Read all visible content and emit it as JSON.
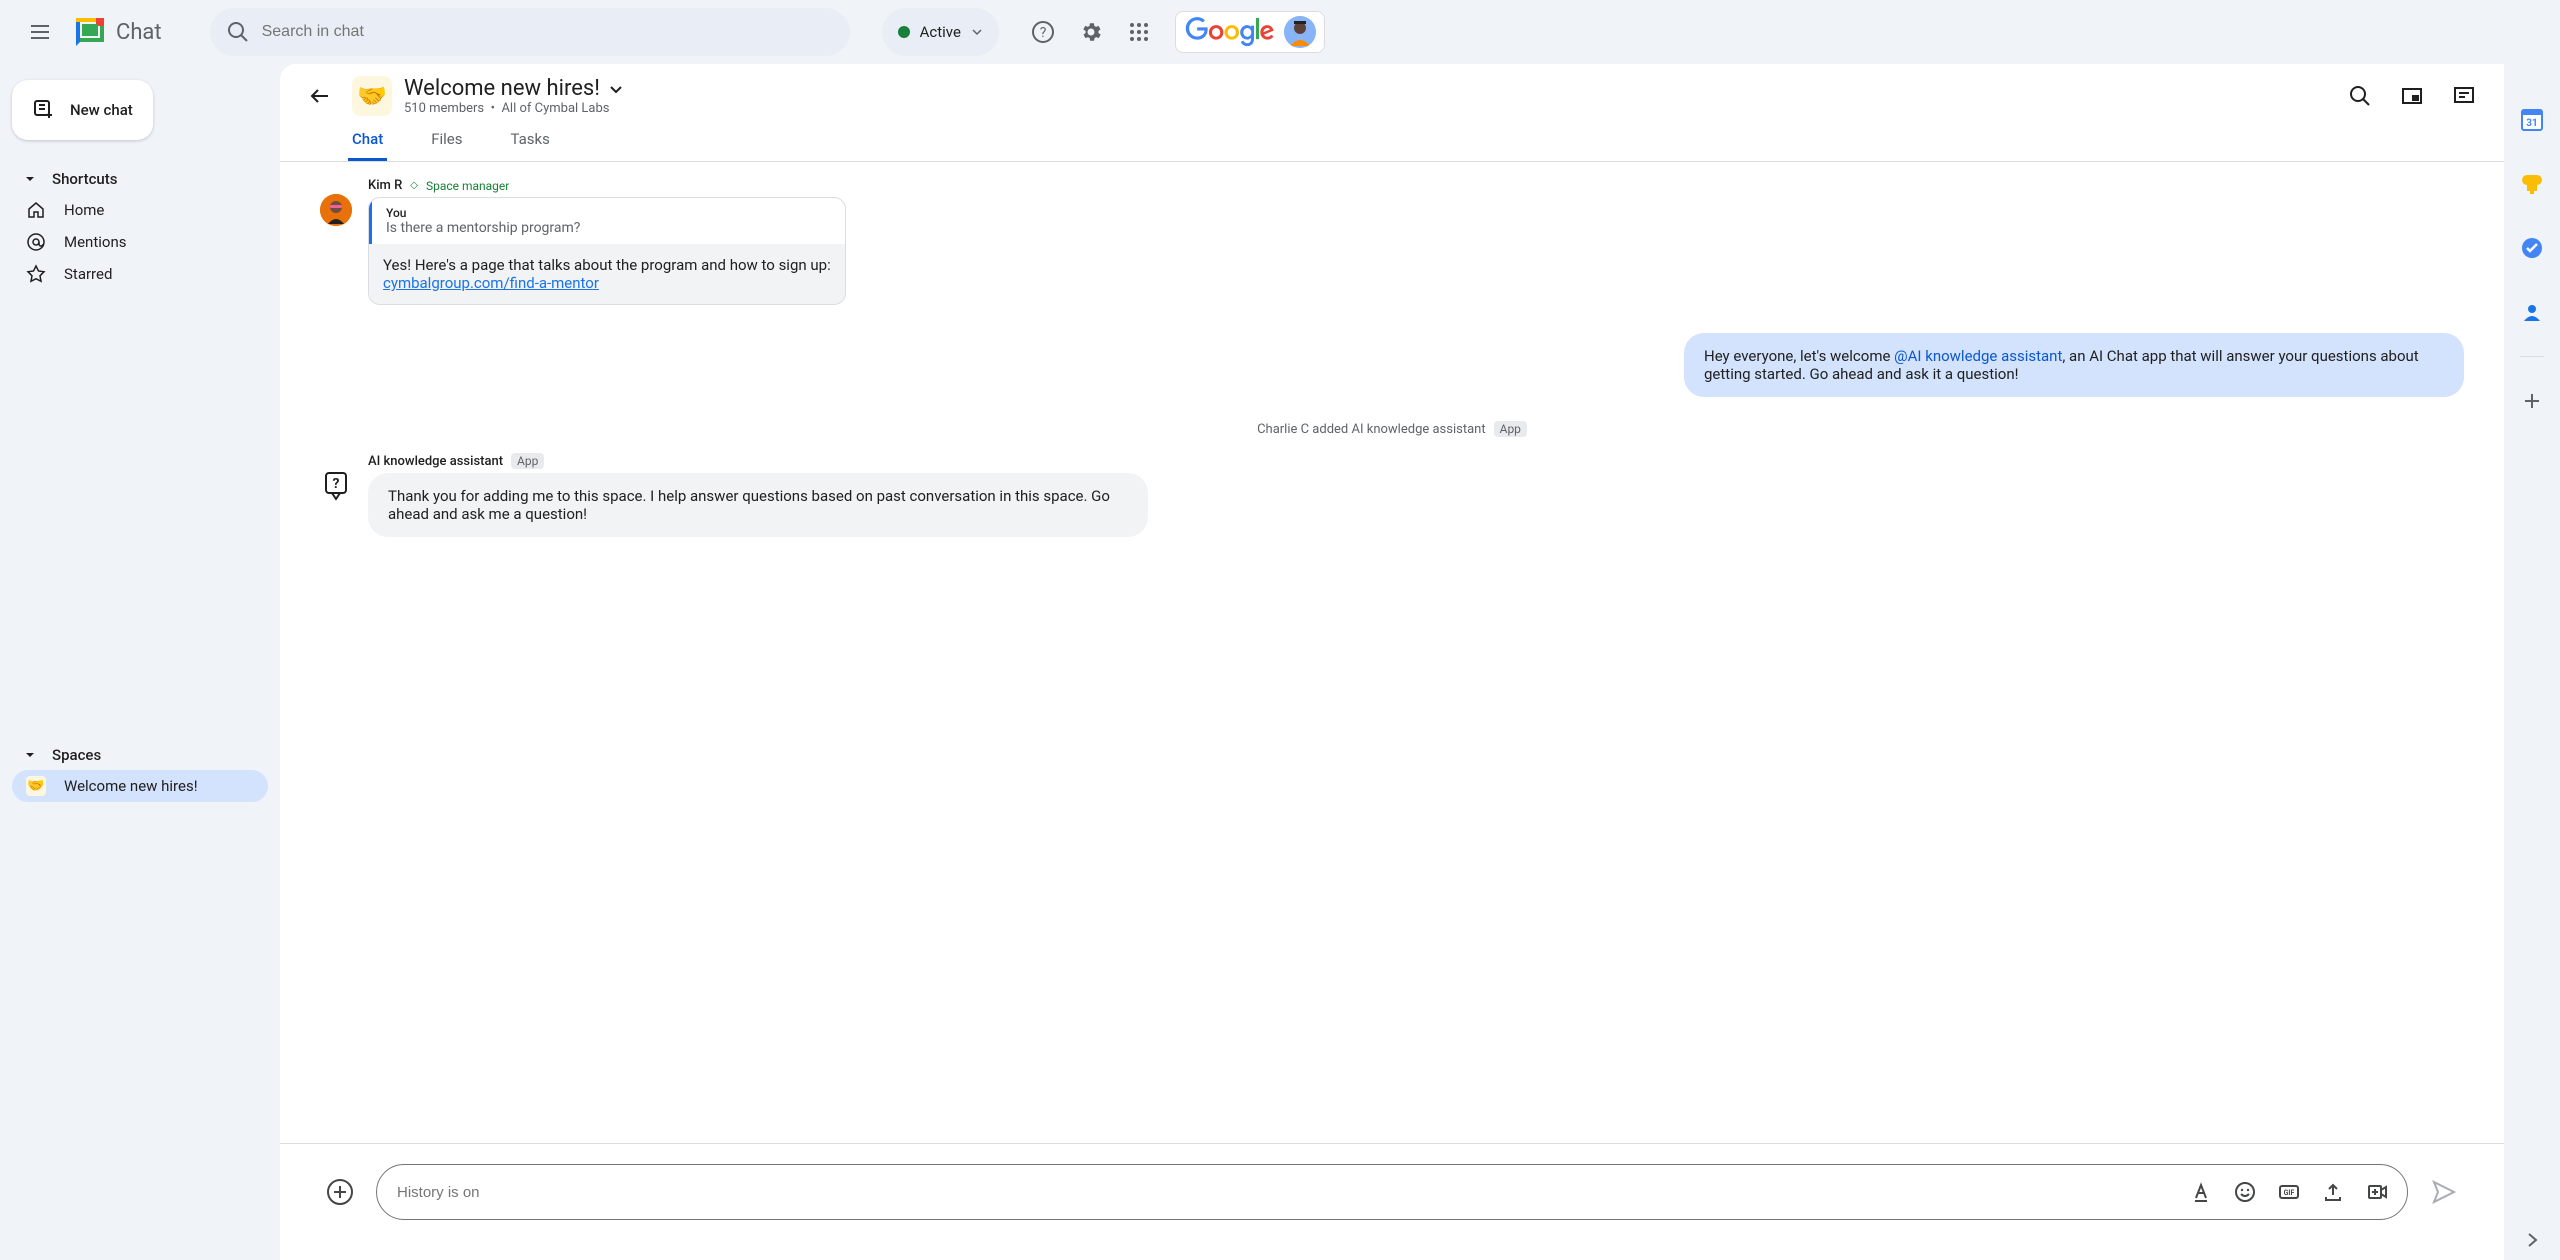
{
  "header": {
    "app_name": "Chat",
    "search_placeholder": "Search in chat",
    "status_text": "Active"
  },
  "sidebar": {
    "new_chat": "New chat",
    "shortcuts_label": "Shortcuts",
    "shortcuts": [
      {
        "label": "Home"
      },
      {
        "label": "Mentions"
      },
      {
        "label": "Starred"
      }
    ],
    "spaces_label": "Spaces",
    "spaces": [
      {
        "emoji": "🤝",
        "name": "Welcome new hires!",
        "selected": true
      }
    ]
  },
  "space": {
    "emoji": "🤝",
    "title": "Welcome new hires!",
    "members_text": "510 members",
    "scope_text": "All of Cymbal Labs",
    "tabs": {
      "chat": "Chat",
      "files": "Files",
      "tasks": "Tasks"
    }
  },
  "messages": {
    "first": {
      "author": "Kim R",
      "role": "Space manager",
      "quote_you": "You",
      "quote_text": "Is there a mentorship program?",
      "reply_line1": "Yes! Here's a page that talks about the program and how to sign up:",
      "reply_link": "cymbalgroup.com/find-a-mentor"
    },
    "announce": {
      "part1": "Hey everyone, let's welcome ",
      "mention": "@AI knowledge assistant",
      "part2": ", an AI Chat app that will answer your questions about getting started.  Go ahead and ask it a question!"
    },
    "system": {
      "text": "Charlie C added AI knowledge assistant",
      "badge": "App"
    },
    "bot": {
      "name": "AI knowledge assistant",
      "badge": "App",
      "text": "Thank you for adding me to this space. I help answer questions based on past conversation in this space. Go ahead and ask me a question!"
    }
  },
  "compose": {
    "placeholder": "History is on"
  }
}
